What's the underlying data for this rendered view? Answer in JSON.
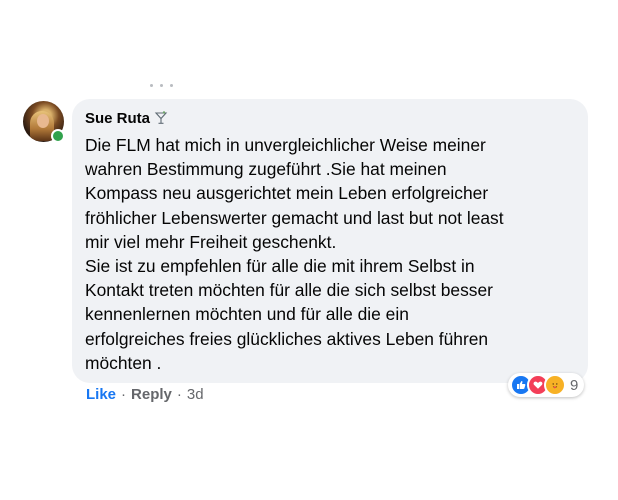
{
  "comment": {
    "author": "Sue Ruta",
    "author_badge_icon": "cocktail-glass-icon",
    "text": "Die FLM hat mich in unvergleichlicher Weise meiner\nwahren Bestimmung zugeführt .Sie hat meinen\nKompass neu ausgerichtet mein Leben erfolgreicher\nfröhlicher Lebenswerter gemacht und last but not least\nmir viel mehr Freiheit geschenkt.\nSie ist zu empfehlen für alle die mit ihrem Selbst in\nKontakt treten möchten für alle die sich selbst besser\nkennenlernen möchten und für alle die ein\nerfolgreiches freies glückliches aktives Leben führen\nmöchten .",
    "online": true
  },
  "reactions": {
    "types": [
      "like",
      "love",
      "care"
    ],
    "count": "9"
  },
  "actions": {
    "like": "Like",
    "separator": "·",
    "reply": "Reply",
    "time": "3d"
  },
  "colors": {
    "bubble": "#f0f2f5",
    "like_blue": "#1877f2",
    "muted_text": "#65676b",
    "online_green": "#31a24c"
  }
}
